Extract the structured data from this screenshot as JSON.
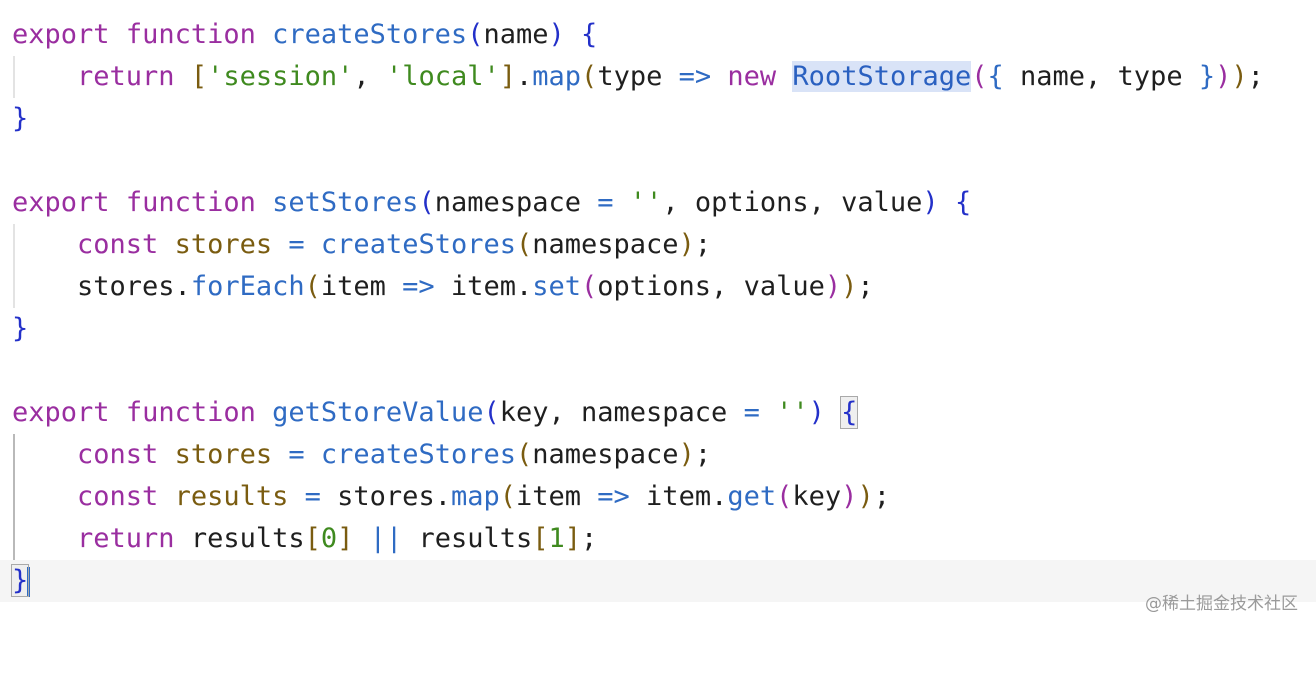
{
  "watermark": "@稀土掘金技术社区",
  "code_lines": [
    "export function createStores(name) {",
    "    return ['session', 'local'].map(type => new RootStorage({ name, type }));",
    "}",
    "",
    "export function setStores(namespace = '', options, value) {",
    "    const stores = createStores(namespace);",
    "    stores.forEach(item => item.set(options, value));",
    "}",
    "",
    "export function getStoreValue(key, namespace = '') {",
    "    const stores = createStores(namespace);",
    "    const results = stores.map(item => item.get(key));",
    "    return results[0] || results[1];",
    "}"
  ],
  "highlighted_symbol": "RootStorage",
  "colors": {
    "keyword": "#9a2ea0",
    "function": "#2f6bc3",
    "variable": "#7a5c10",
    "string": "#3f8a1f",
    "cursor": "#2f6bc3"
  }
}
